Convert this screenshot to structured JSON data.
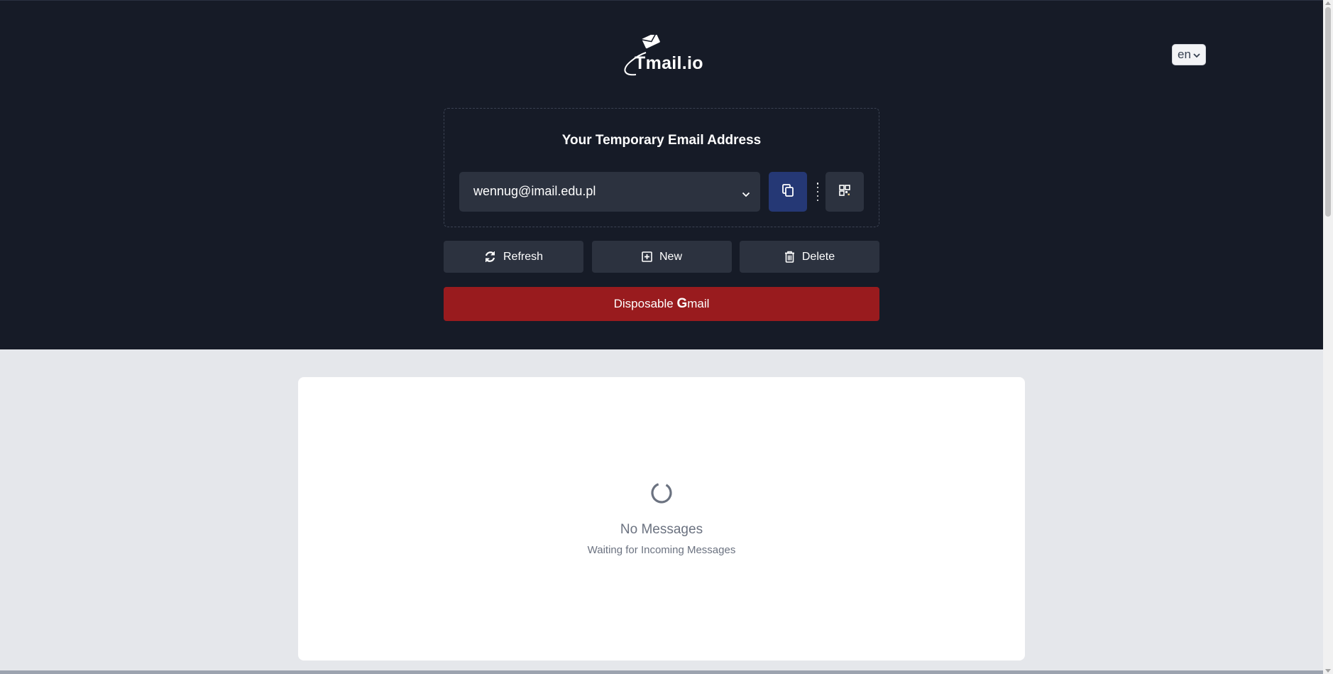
{
  "brand": {
    "logo_text": "Tmail.io"
  },
  "language": {
    "selected": "en"
  },
  "email_panel": {
    "title": "Your Temporary Email Address",
    "current_email": "wennug@imail.edu.pl"
  },
  "actions": {
    "refresh_label": "Refresh",
    "new_label": "New",
    "delete_label": "Delete"
  },
  "gmail_button": {
    "prefix": "Disposable ",
    "g": "G",
    "suffix": "mail"
  },
  "inbox": {
    "empty_title": "No Messages",
    "empty_subtitle": "Waiting for Incoming Messages"
  },
  "icons": {
    "logo": "envelope-flying-icon",
    "copy": "copy-icon",
    "more": "vertical-dots-icon",
    "qr": "qr-code-icon",
    "refresh": "refresh-icon",
    "new": "plus-square-icon",
    "delete": "trash-icon",
    "loading": "spinner-icon"
  },
  "colors": {
    "header_bg": "#161b27",
    "copy_button": "#253875",
    "gmail_button": "#991b1e",
    "page_bg": "#e5e7eb"
  }
}
